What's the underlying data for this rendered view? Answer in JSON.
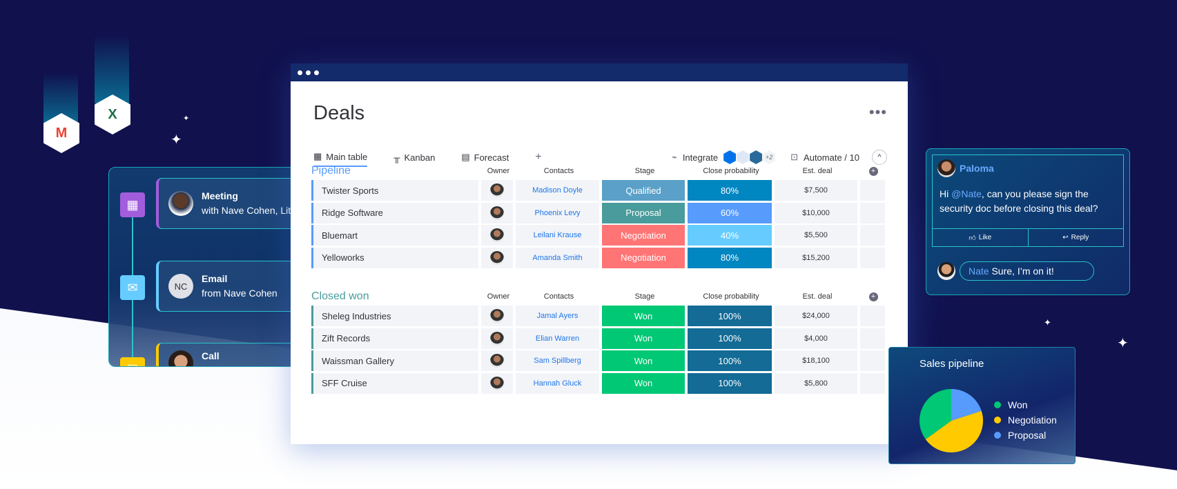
{
  "background_apps": [
    {
      "icon": "gmail-icon",
      "glyph": "M"
    },
    {
      "icon": "excel-icon",
      "glyph": "X"
    }
  ],
  "timeline": [
    {
      "type": "Meeting",
      "detail": "with Nave Cohen, Lita",
      "color": "#a25ddc",
      "icon": "calendar-icon"
    },
    {
      "type": "Email",
      "detail": "from Nave Cohen",
      "color": "#66ccff",
      "icon": "mail-icon",
      "initials": "NC"
    },
    {
      "type": "Call",
      "detail": "",
      "color": "#ffcb00",
      "icon": "phone-icon"
    }
  ],
  "board": {
    "title": "Deals",
    "tabs": [
      {
        "label": "Main table",
        "icon": "table-icon"
      },
      {
        "label": "Kanban",
        "icon": "kanban-icon"
      },
      {
        "label": "Forecast",
        "icon": "forecast-icon"
      }
    ],
    "add_tab": "+",
    "integrate": "Integrate",
    "integrations_more": "+2",
    "automate": "Automate / 10",
    "columns": {
      "owner": "Owner",
      "contacts": "Contacts",
      "stage": "Stage",
      "prob": "Close probability",
      "est": "Est. deal"
    },
    "groups": [
      {
        "title": "Pipeline",
        "color": "#579bfc",
        "rows": [
          {
            "name": "Twister Sports",
            "contact": "Madison Doyle",
            "stage": "Qualified",
            "stage_color": "#5aa0c8",
            "prob": "80%",
            "prob_color": "#0086c0",
            "est": "$7,500"
          },
          {
            "name": "Ridge Software",
            "contact": "Phoenix Levy",
            "stage": "Proposal",
            "stage_color": "#4a9c9c",
            "prob": "60%",
            "prob_color": "#579bfc",
            "est": "$10,000"
          },
          {
            "name": "Bluemart",
            "contact": "Leilani Krause",
            "stage": "Negotiation",
            "stage_color": "#ff7575",
            "prob": "40%",
            "prob_color": "#66ccff",
            "est": "$5,500"
          },
          {
            "name": "Yelloworks",
            "contact": "Amanda Smith",
            "stage": "Negotiation",
            "stage_color": "#ff7575",
            "prob": "80%",
            "prob_color": "#0086c0",
            "est": "$15,200"
          }
        ]
      },
      {
        "title": "Closed won",
        "color": "#4a9c9c",
        "rows": [
          {
            "name": "Sheleg Industries",
            "contact": "Jamal Ayers",
            "stage": "Won",
            "stage_color": "#00c875",
            "prob": "100%",
            "prob_color": "#136b96",
            "est": "$24,000"
          },
          {
            "name": "Zift Records",
            "contact": "Elian Warren",
            "stage": "Won",
            "stage_color": "#00c875",
            "prob": "100%",
            "prob_color": "#136b96",
            "est": "$4,000"
          },
          {
            "name": "Waissman Gallery",
            "contact": "Sam Spillberg",
            "stage": "Won",
            "stage_color": "#00c875",
            "prob": "100%",
            "prob_color": "#136b96",
            "est": "$18,100"
          },
          {
            "name": "SFF Cruise",
            "contact": "Hannah Gluck",
            "stage": "Won",
            "stage_color": "#00c875",
            "prob": "100%",
            "prob_color": "#136b96",
            "est": "$5,800"
          }
        ]
      }
    ]
  },
  "comment": {
    "author": "Paloma",
    "text_pre": "Hi ",
    "mention": "@Nate",
    "text_post": ", can you please sign the security doc before closing this deal?",
    "like": "Like",
    "reply": "Reply",
    "reply_author": "Nate",
    "reply_text": "Sure, I’m on it!"
  },
  "chart_data": {
    "type": "pie",
    "title": "Sales pipeline",
    "legend": "right",
    "series": [
      {
        "name": "Won",
        "value": 35,
        "color": "#00c875"
      },
      {
        "name": "Negotiation",
        "value": 45,
        "color": "#ffcb00"
      },
      {
        "name": "Proposal",
        "value": 20,
        "color": "#579bfc"
      }
    ]
  }
}
